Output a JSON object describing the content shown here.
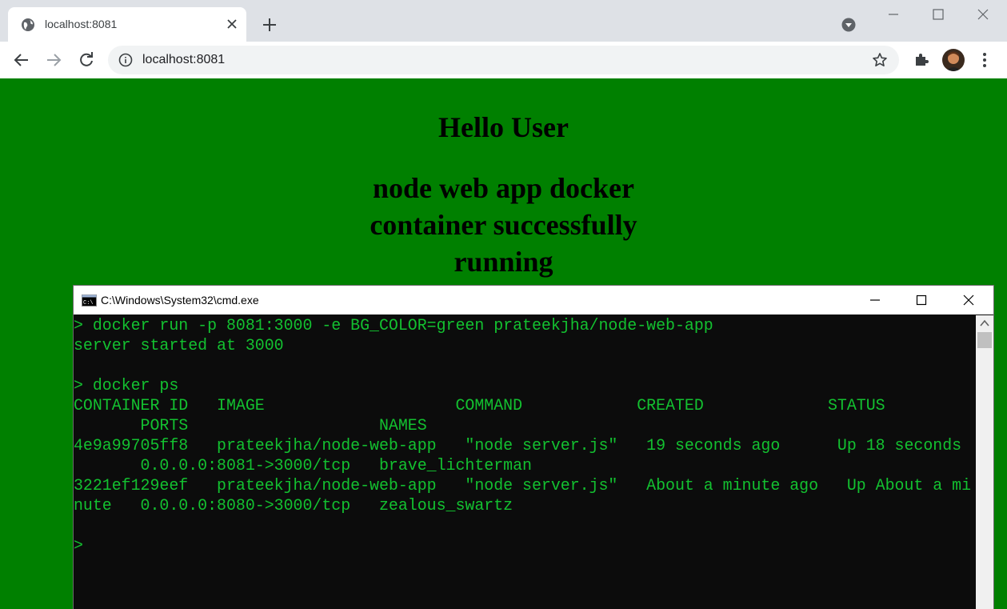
{
  "browser": {
    "tab_title": "localhost:8081",
    "url": "localhost:8081"
  },
  "page": {
    "heading": "Hello User",
    "subheading": "node web app docker container successfully running",
    "background_color": "#008000"
  },
  "cmd": {
    "title": "C:\\Windows\\System32\\cmd.exe",
    "text_color": "#13c130",
    "lines": [
      "> docker run -p 8081:3000 -e BG_COLOR=green prateekjha/node-web-app",
      "server started at 3000",
      "",
      "> docker ps",
      "CONTAINER ID   IMAGE                    COMMAND            CREATED             STATUS",
      "       PORTS                    NAMES",
      "4e9a99705ff8   prateekjha/node-web-app   \"node server.js\"   19 seconds ago      Up 18 seconds",
      "       0.0.0.0:8081->3000/tcp   brave_lichterman",
      "3221ef129eef   prateekjha/node-web-app   \"node server.js\"   About a minute ago   Up About a mi",
      "nute   0.0.0.0:8080->3000/tcp   zealous_swartz",
      "",
      ">"
    ]
  },
  "icons": {
    "favicon": "globe-icon",
    "tab_close": "close-icon",
    "new_tab": "plus-icon",
    "back": "back-arrow-icon",
    "forward": "forward-arrow-icon",
    "reload": "reload-icon",
    "site_info": "info-icon",
    "bookmark": "star-icon",
    "extensions": "puzzle-icon",
    "menu": "kebab-menu-icon"
  }
}
